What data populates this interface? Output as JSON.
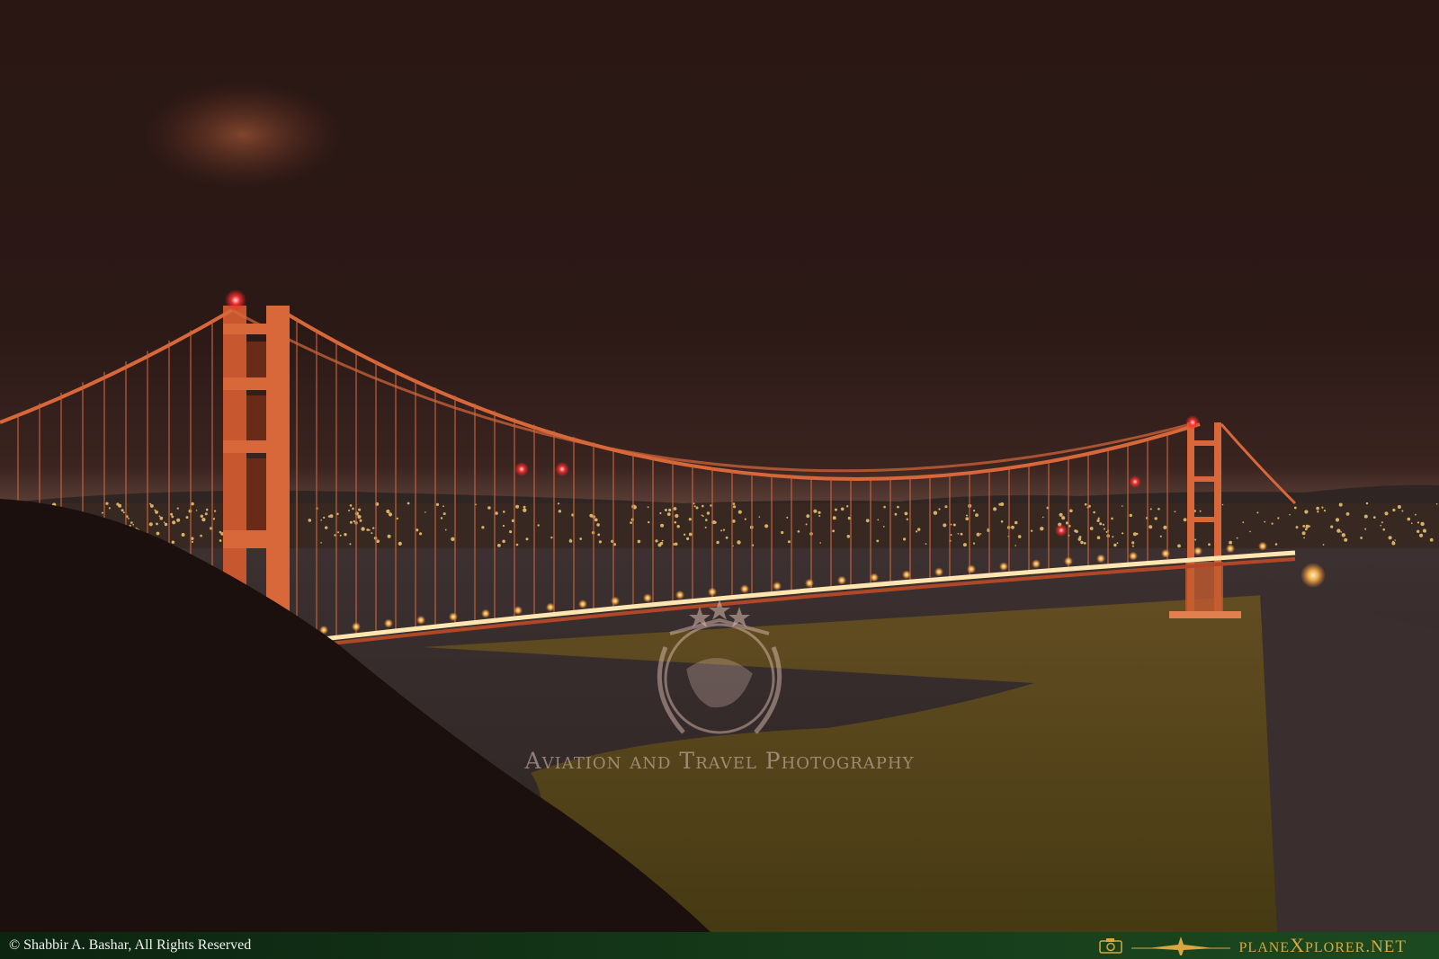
{
  "watermark": {
    "tagline": "Aviation and Travel Photography"
  },
  "footer": {
    "copyright": "© Shabbir A. Bashar, All Rights Reserved",
    "brand_prefix": "plane",
    "brand_mid": "X",
    "brand_rest": "plorer",
    "brand_suffix": ".NET"
  },
  "icons": [
    "camera-icon",
    "airplane-icon",
    "laurel-wreath-icon",
    "globe-icon",
    "star-icon"
  ],
  "colors": {
    "sky": "#2a1714",
    "bridge": "#d8683a",
    "lights": "#ffc66a",
    "water_glow": "#6a5418",
    "footer_bg": "#143618",
    "brand_gold": "#d9a640"
  }
}
